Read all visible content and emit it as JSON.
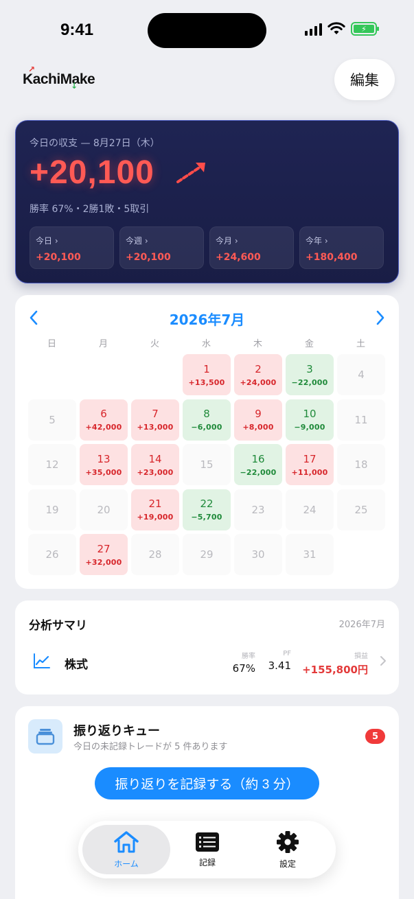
{
  "status_bar": {
    "time": "9:41"
  },
  "app": {
    "logo": "KachiMake",
    "edit_label": "編集"
  },
  "summary": {
    "date_label": "今日の収支 — 8月27日（木）",
    "amount": "+20,100",
    "stats": "勝率 67%・2勝1敗・5取引",
    "periods": [
      {
        "label": "今日 ›",
        "value": "+20,100"
      },
      {
        "label": "今週 ›",
        "value": "+20,100"
      },
      {
        "label": "今月 ›",
        "value": "+24,600"
      },
      {
        "label": "今年 ›",
        "value": "+180,400"
      }
    ]
  },
  "calendar": {
    "title": "2026年7月",
    "weekdays": [
      "日",
      "月",
      "火",
      "水",
      "木",
      "金",
      "土"
    ],
    "cells": [
      {
        "day": "",
        "pnl": "",
        "state": "empty"
      },
      {
        "day": "",
        "pnl": "",
        "state": "empty"
      },
      {
        "day": "",
        "pnl": "",
        "state": "empty"
      },
      {
        "day": "1",
        "pnl": "+13,500",
        "state": "win"
      },
      {
        "day": "2",
        "pnl": "+24,000",
        "state": "win"
      },
      {
        "day": "3",
        "pnl": "−22,000",
        "state": "loss"
      },
      {
        "day": "4",
        "pnl": "",
        "state": "none"
      },
      {
        "day": "5",
        "pnl": "",
        "state": "none"
      },
      {
        "day": "6",
        "pnl": "+42,000",
        "state": "win"
      },
      {
        "day": "7",
        "pnl": "+13,000",
        "state": "win"
      },
      {
        "day": "8",
        "pnl": "−6,000",
        "state": "loss"
      },
      {
        "day": "9",
        "pnl": "+8,000",
        "state": "win"
      },
      {
        "day": "10",
        "pnl": "−9,000",
        "state": "loss"
      },
      {
        "day": "11",
        "pnl": "",
        "state": "none"
      },
      {
        "day": "12",
        "pnl": "",
        "state": "none"
      },
      {
        "day": "13",
        "pnl": "+35,000",
        "state": "win"
      },
      {
        "day": "14",
        "pnl": "+23,000",
        "state": "win"
      },
      {
        "day": "15",
        "pnl": "",
        "state": "none"
      },
      {
        "day": "16",
        "pnl": "−22,000",
        "state": "loss"
      },
      {
        "day": "17",
        "pnl": "+11,000",
        "state": "win"
      },
      {
        "day": "18",
        "pnl": "",
        "state": "none"
      },
      {
        "day": "19",
        "pnl": "",
        "state": "none"
      },
      {
        "day": "20",
        "pnl": "",
        "state": "none"
      },
      {
        "day": "21",
        "pnl": "+19,000",
        "state": "win"
      },
      {
        "day": "22",
        "pnl": "−5,700",
        "state": "loss"
      },
      {
        "day": "23",
        "pnl": "",
        "state": "none"
      },
      {
        "day": "24",
        "pnl": "",
        "state": "none"
      },
      {
        "day": "25",
        "pnl": "",
        "state": "none"
      },
      {
        "day": "26",
        "pnl": "",
        "state": "none"
      },
      {
        "day": "27",
        "pnl": "+32,000",
        "state": "win"
      },
      {
        "day": "28",
        "pnl": "",
        "state": "none"
      },
      {
        "day": "29",
        "pnl": "",
        "state": "none"
      },
      {
        "day": "30",
        "pnl": "",
        "state": "none"
      },
      {
        "day": "31",
        "pnl": "",
        "state": "none"
      }
    ]
  },
  "analysis": {
    "title": "分析サマリ",
    "period": "2026年7月",
    "rows": [
      {
        "asset": "株式",
        "win_rate_label": "勝率",
        "win_rate": "67%",
        "pf_label": "PF",
        "pf": "3.41",
        "pnl_label": "損益",
        "pnl": "+155,800円"
      }
    ]
  },
  "review": {
    "title": "振り返りキュー",
    "subtitle": "今日の未記録トレードが 5 件あります",
    "badge": "5",
    "button_label": "振り返りを記録する（約 3 分）"
  },
  "tabs": [
    {
      "label": "ホーム",
      "icon": "house-icon",
      "active": true
    },
    {
      "label": "記録",
      "icon": "list-icon",
      "active": false
    },
    {
      "label": "設定",
      "icon": "gear-icon",
      "active": false
    }
  ],
  "colors": {
    "accent": "#1a8cff",
    "profit": "#e33a3a",
    "loss": "#1f8a3a",
    "summary_bg": "#1f2453"
  }
}
